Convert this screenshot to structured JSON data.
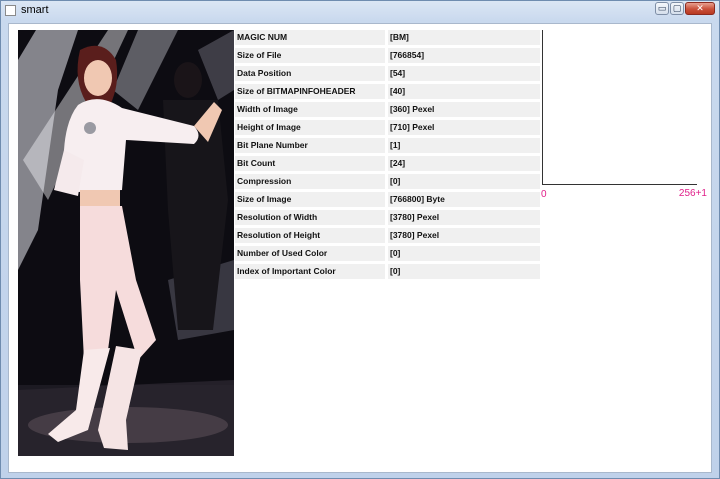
{
  "window": {
    "title": "smart",
    "controls": {
      "minimize": "▭",
      "maximize": "▢",
      "close": "✕"
    }
  },
  "bmp_info": [
    {
      "label": "MAGIC NUM",
      "value": "[BM]"
    },
    {
      "label": "Size of File",
      "value": "[766854]"
    },
    {
      "label": "Data Position",
      "value": "[54]"
    },
    {
      "label": "Size of BITMAPINFOHEADER",
      "value": "[40]"
    },
    {
      "label": "Width of Image",
      "value": "[360] Pexel"
    },
    {
      "label": "Height of Image",
      "value": "[710] Pexel"
    },
    {
      "label": "Bit Plane Number",
      "value": "[1]"
    },
    {
      "label": "Bit Count",
      "value": "[24]"
    },
    {
      "label": "Compression",
      "value": "[0]"
    },
    {
      "label": "Size of Image",
      "value": "[766800] Byte"
    },
    {
      "label": "Resolution of Width",
      "value": "[3780] Pexel"
    },
    {
      "label": "Resolution of Height",
      "value": "[3780] Pexel"
    },
    {
      "label": "Number of Used Color",
      "value": "[0]"
    },
    {
      "label": "Index of Important Color",
      "value": "[0]"
    }
  ],
  "histogram": {
    "x_min_label": "0",
    "x_max_label": "256+1",
    "axis_color": "#333333",
    "label_color": "#e0208a"
  }
}
